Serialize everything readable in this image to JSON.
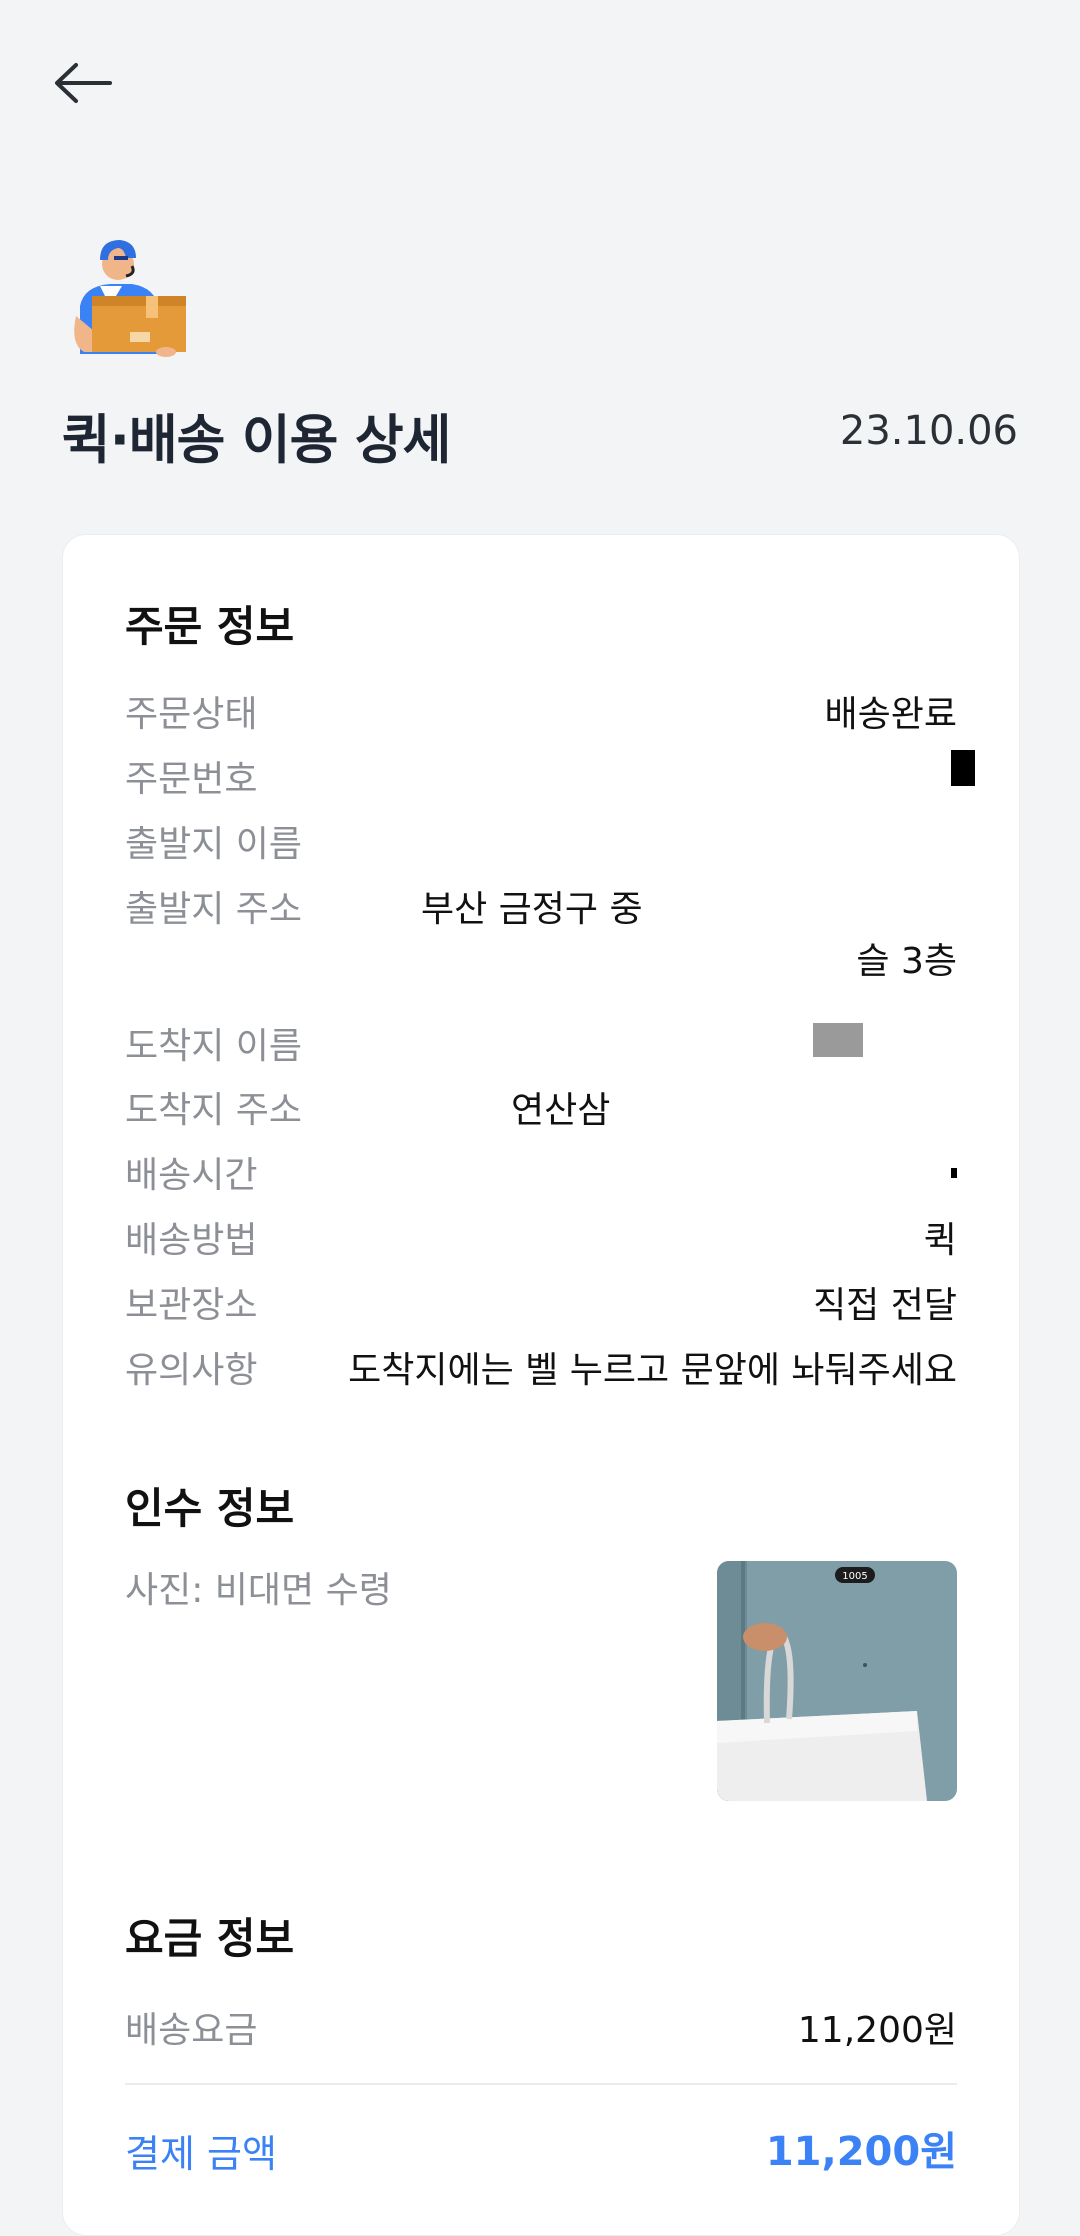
{
  "header": {
    "title": "퀵·배송 이용 상세",
    "date": "23.10.06"
  },
  "order_info": {
    "section_title": "주문 정보",
    "rows": [
      {
        "label": "주문상태",
        "value": "배송완료"
      },
      {
        "label": "주문번호",
        "value": ""
      },
      {
        "label": "출발지 이름",
        "value": ""
      },
      {
        "label": "출발지 주소",
        "value_line1": "부산 금정구 중",
        "value_line2": "슬 3층"
      },
      {
        "label": "도착지 이름",
        "value": ""
      },
      {
        "label": "도착지 주소",
        "value": "연산삼"
      },
      {
        "label": "배송시간",
        "value": ""
      },
      {
        "label": "배송방법",
        "value": "퀵"
      },
      {
        "label": "보관장소",
        "value": "직접 전달"
      },
      {
        "label": "유의사항",
        "value": "도착지에는 벨 누르고 문앞에 놔둬주세요"
      }
    ]
  },
  "receipt_info": {
    "section_title": "인수 정보",
    "photo_caption": "사진: 비대면 수령",
    "photo_door_number": "1005"
  },
  "fee_info": {
    "section_title": "요금 정보",
    "delivery_fee_label": "배송요금",
    "delivery_fee_value": "11,200원",
    "payment_label": "결제 금액",
    "payment_value": "11,200원"
  },
  "colors": {
    "background": "#f3f4f6",
    "card": "#ffffff",
    "label_gray": "#8c9096",
    "accent_blue": "#3b82f6",
    "title": "#1f2633"
  },
  "icons": {
    "back": "arrow-left-icon",
    "hero": "delivery-person-icon"
  }
}
